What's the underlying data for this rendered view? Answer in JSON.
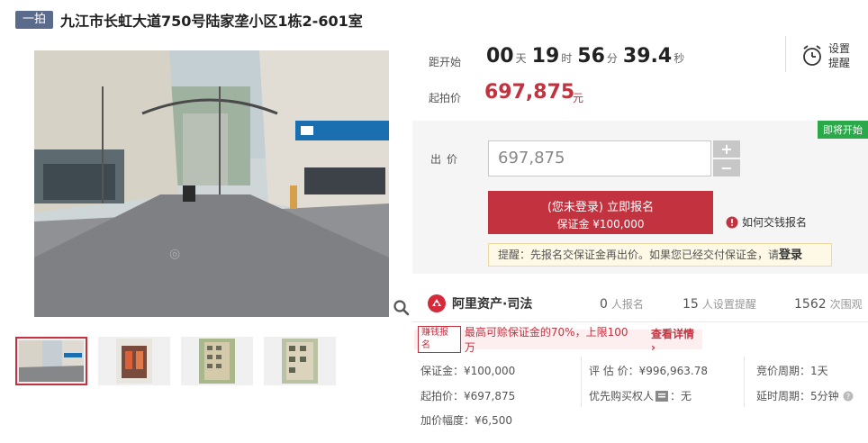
{
  "header": {
    "badge": "一拍",
    "title": "九江市长虹大道750号陆家垄小区1栋2-601室"
  },
  "countdown": {
    "label": "距开始",
    "days": "00",
    "days_unit": "天",
    "hours": "19",
    "hours_unit": "时",
    "minutes": "56",
    "minutes_unit": "分",
    "seconds": "39.4",
    "seconds_unit": "秒"
  },
  "starting_price": {
    "label": "起拍价",
    "value": "697,875",
    "unit": "元"
  },
  "reminder": {
    "icon": "alarm-clock-icon",
    "label": "设置提醒"
  },
  "bid": {
    "status_tag": "即将开始",
    "label": "出价",
    "input_value": "697,875",
    "plus": "+",
    "minus": "−",
    "signup_main": "(您未登录) 立即报名",
    "signup_sub": "保证金 ¥100,000",
    "howto": "如何交钱报名",
    "notice_text": "提醒：先报名交保证金再出价。如果您已经交付保证金，请",
    "notice_login": "登录"
  },
  "platform": {
    "brand": "阿里资产·司法",
    "signups": "0",
    "signups_unit": "人报名",
    "reminders": "15",
    "reminders_unit": "人设置提醒",
    "views": "1562",
    "views_unit": "次围观"
  },
  "promo": {
    "tag": "赚钱报名",
    "text": "最高可赊保证金的70%，上限100万",
    "link": "查看详情 ›"
  },
  "details": {
    "deposit": "保证金：¥100,000",
    "start_price": "起拍价：¥697,875",
    "increment": "加价幅度：¥6,500",
    "appraisal": "评 估 价：¥996,963.78",
    "priority": "优先购买权人",
    "priority_value": "：无",
    "cycle": "竞价周期：1天",
    "delay": "延时周期：5分钟"
  },
  "colors": {
    "accent": "#c3323f",
    "badge_bg": "#5b6b8c",
    "soon_tag": "#2aa84a"
  }
}
